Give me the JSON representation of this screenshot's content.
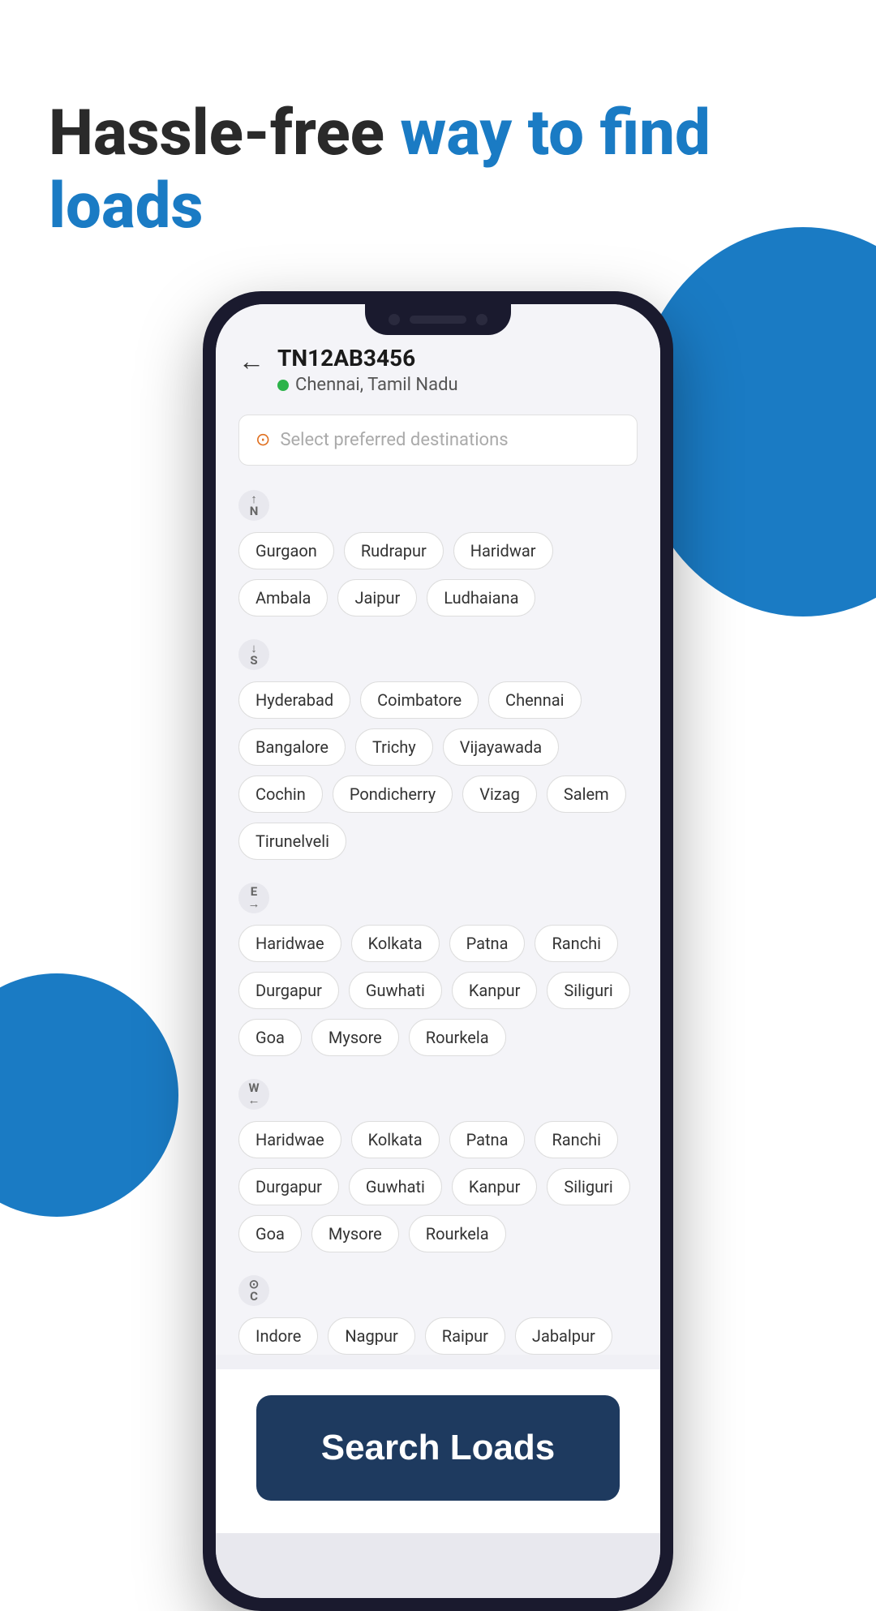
{
  "headline": {
    "part1": "Hassle-free ",
    "part2": "way to find loads"
  },
  "phone": {
    "header": {
      "back_label": "←",
      "plate": "TN12AB3456",
      "location": "Chennai, Tamil Nadu"
    },
    "search": {
      "placeholder": "Select preferred destinations"
    },
    "directions": [
      {
        "id": "north",
        "icon": "N",
        "icon_label": "north-direction-icon",
        "chips": [
          "Gurgaon",
          "Rudrapur",
          "Haridwar",
          "Ambala",
          "Jaipur",
          "Ludhaiana"
        ]
      },
      {
        "id": "south",
        "icon": "S",
        "icon_label": "south-direction-icon",
        "chips": [
          "Hyderabad",
          "Coimbatore",
          "Chennai",
          "Bangalore",
          "Trichy",
          "Vijayawada",
          "Cochin",
          "Pondicherry",
          "Vizag",
          "Salem",
          "Tirunelveli"
        ]
      },
      {
        "id": "east",
        "icon": "E",
        "icon_label": "east-direction-icon",
        "chips": [
          "Haridwae",
          "Kolkata",
          "Patna",
          "Ranchi",
          "Durgapur",
          "Guwhati",
          "Kanpur",
          "Siliguri",
          "Goa",
          "Mysore",
          "Rourkela"
        ]
      },
      {
        "id": "west",
        "icon": "W",
        "icon_label": "west-direction-icon",
        "chips": [
          "Haridwae",
          "Kolkata",
          "Patna",
          "Ranchi",
          "Durgapur",
          "Guwhati",
          "Kanpur",
          "Siliguri",
          "Goa",
          "Mysore",
          "Rourkela"
        ]
      },
      {
        "id": "central",
        "icon": "C",
        "icon_label": "central-direction-icon",
        "chips": [
          "Indore",
          "Nagpur",
          "Raipur",
          "Jabalpur"
        ]
      }
    ],
    "button_label": "Search Loads"
  }
}
